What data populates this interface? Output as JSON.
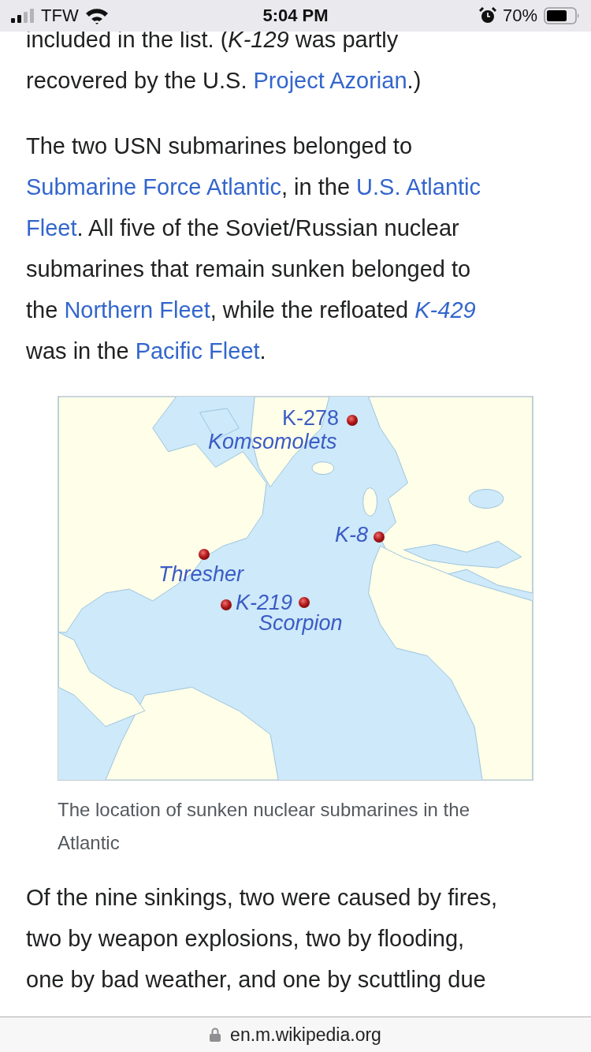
{
  "status_bar": {
    "carrier": "TFW",
    "time": "5:04 PM",
    "battery": "70%"
  },
  "paragraphs": [
    {
      "lines": [
        [
          {
            "kind": "text",
            "text": "included in the list. ("
          },
          {
            "kind": "italic",
            "text": "K-129"
          },
          {
            "kind": "text",
            "text": " was partly"
          }
        ],
        [
          {
            "kind": "text",
            "text": "recovered by the U.S. "
          },
          {
            "kind": "link",
            "text": "Project Azorian"
          },
          {
            "kind": "text",
            "text": ".)"
          }
        ]
      ]
    },
    {
      "lines": [
        [
          {
            "kind": "text",
            "text": "The two USN submarines belonged to"
          }
        ],
        [
          {
            "kind": "link",
            "text": "Submarine Force Atlantic"
          },
          {
            "kind": "text",
            "text": ", in the "
          },
          {
            "kind": "link",
            "text": "U.S. Atlantic"
          }
        ],
        [
          {
            "kind": "link",
            "text": "Fleet"
          },
          {
            "kind": "text",
            "text": ". All five of the Soviet/Russian nuclear"
          }
        ],
        [
          {
            "kind": "text",
            "text": "submarines that remain sunken belonged to"
          }
        ],
        [
          {
            "kind": "text",
            "text": "the "
          },
          {
            "kind": "link",
            "text": "Northern Fleet"
          },
          {
            "kind": "text",
            "text": ", while the refloated "
          },
          {
            "kind": "italic-link",
            "text": "K-429"
          }
        ],
        [
          {
            "kind": "text",
            "text": "was in the "
          },
          {
            "kind": "link",
            "text": "Pacific Fleet"
          },
          {
            "kind": "text",
            "text": "."
          }
        ]
      ]
    }
  ],
  "figure": {
    "locations": [
      {
        "labels": [
          {
            "text": "K-278",
            "italic": false
          },
          {
            "text": "Komsomolets",
            "italic": true
          }
        ]
      },
      {
        "labels": [
          {
            "text": "K-8",
            "italic": true
          }
        ]
      },
      {
        "labels": [
          {
            "text": "Thresher",
            "italic": true
          }
        ]
      },
      {
        "labels": [
          {
            "text": "K-219",
            "italic": true
          }
        ]
      },
      {
        "labels": [
          {
            "text": "Scorpion",
            "italic": true
          }
        ]
      }
    ],
    "caption": "The location of sunken nuclear submarines in the Atlantic"
  },
  "paragraphs_after": [
    {
      "lines": [
        [
          {
            "kind": "text",
            "text": "Of the nine sinkings, two were caused by fires,"
          }
        ],
        [
          {
            "kind": "text",
            "text": "two by weapon explosions, two by flooding,"
          }
        ],
        [
          {
            "kind": "text",
            "text": "one by bad weather, and one by scuttling due"
          }
        ]
      ]
    }
  ],
  "address_bar": {
    "url": "en.m.wikipedia.org"
  }
}
